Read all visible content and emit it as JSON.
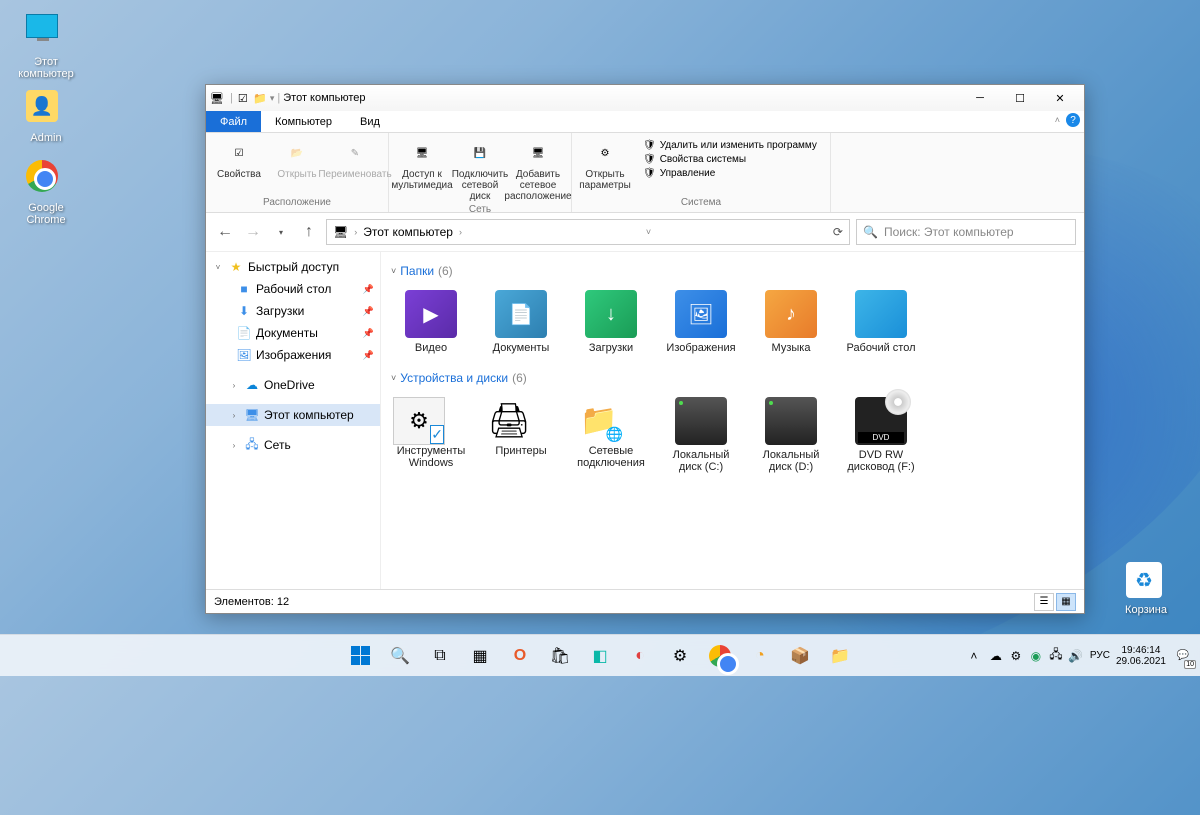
{
  "desktop": {
    "icons": [
      {
        "label": "Этот компьютер",
        "icon": "this-pc"
      },
      {
        "label": "Admin",
        "icon": "user-folder"
      },
      {
        "label": "Google Chrome",
        "icon": "chrome"
      }
    ],
    "recycle": "Корзина"
  },
  "window": {
    "title": "Этот компьютер",
    "tabs": {
      "file": "Файл",
      "computer": "Компьютер",
      "view": "Вид"
    },
    "ribbon": {
      "group_location": "Расположение",
      "group_network": "Сеть",
      "group_system": "Система",
      "props": "Свойства",
      "open": "Открыть",
      "rename": "Переименовать",
      "media": "Доступ к мультимедиа",
      "netdrive": "Подключить сетевой диск",
      "addnet": "Добавить сетевое расположение",
      "params": "Открыть параметры",
      "sys1": "Удалить или изменить программу",
      "sys2": "Свойства системы",
      "sys3": "Управление"
    },
    "address": {
      "root": "Этот компьютер",
      "search_placeholder": "Поиск: Этот компьютер"
    },
    "sidebar": {
      "quick": "Быстрый доступ",
      "desktop": "Рабочий стол",
      "downloads": "Загрузки",
      "documents": "Документы",
      "pictures": "Изображения",
      "onedrive": "OneDrive",
      "thispc": "Этот компьютер",
      "network": "Сеть"
    },
    "sections": {
      "folders_title": "Папки",
      "folders_count": "(6)",
      "devices_title": "Устройства и диски",
      "devices_count": "(6)"
    },
    "folders": [
      {
        "label": "Видео",
        "glyph": "▶",
        "cls": "ft-video"
      },
      {
        "label": "Документы",
        "glyph": "📄",
        "cls": "ft-docs"
      },
      {
        "label": "Загрузки",
        "glyph": "↓",
        "cls": "ft-dl"
      },
      {
        "label": "Изображения",
        "glyph": "🖼",
        "cls": "ft-img"
      },
      {
        "label": "Музыка",
        "glyph": "♪",
        "cls": "ft-music"
      },
      {
        "label": "Рабочий стол",
        "glyph": "",
        "cls": "ft-desk"
      }
    ],
    "devices": [
      {
        "label": "Инструменты Windows",
        "type": "tools"
      },
      {
        "label": "Принтеры",
        "type": "printer"
      },
      {
        "label": "Сетевые подключения",
        "type": "netconn"
      },
      {
        "label": "Локальный диск (C:)",
        "type": "drive"
      },
      {
        "label": "Локальный диск (D:)",
        "type": "drive"
      },
      {
        "label": "DVD RW дисковод (F:)",
        "type": "dvd"
      }
    ],
    "status": "Элементов: 12"
  },
  "taskbar": {
    "lang": "РУС",
    "time": "19:46:14",
    "date": "29.06.2021",
    "notif": "10"
  }
}
